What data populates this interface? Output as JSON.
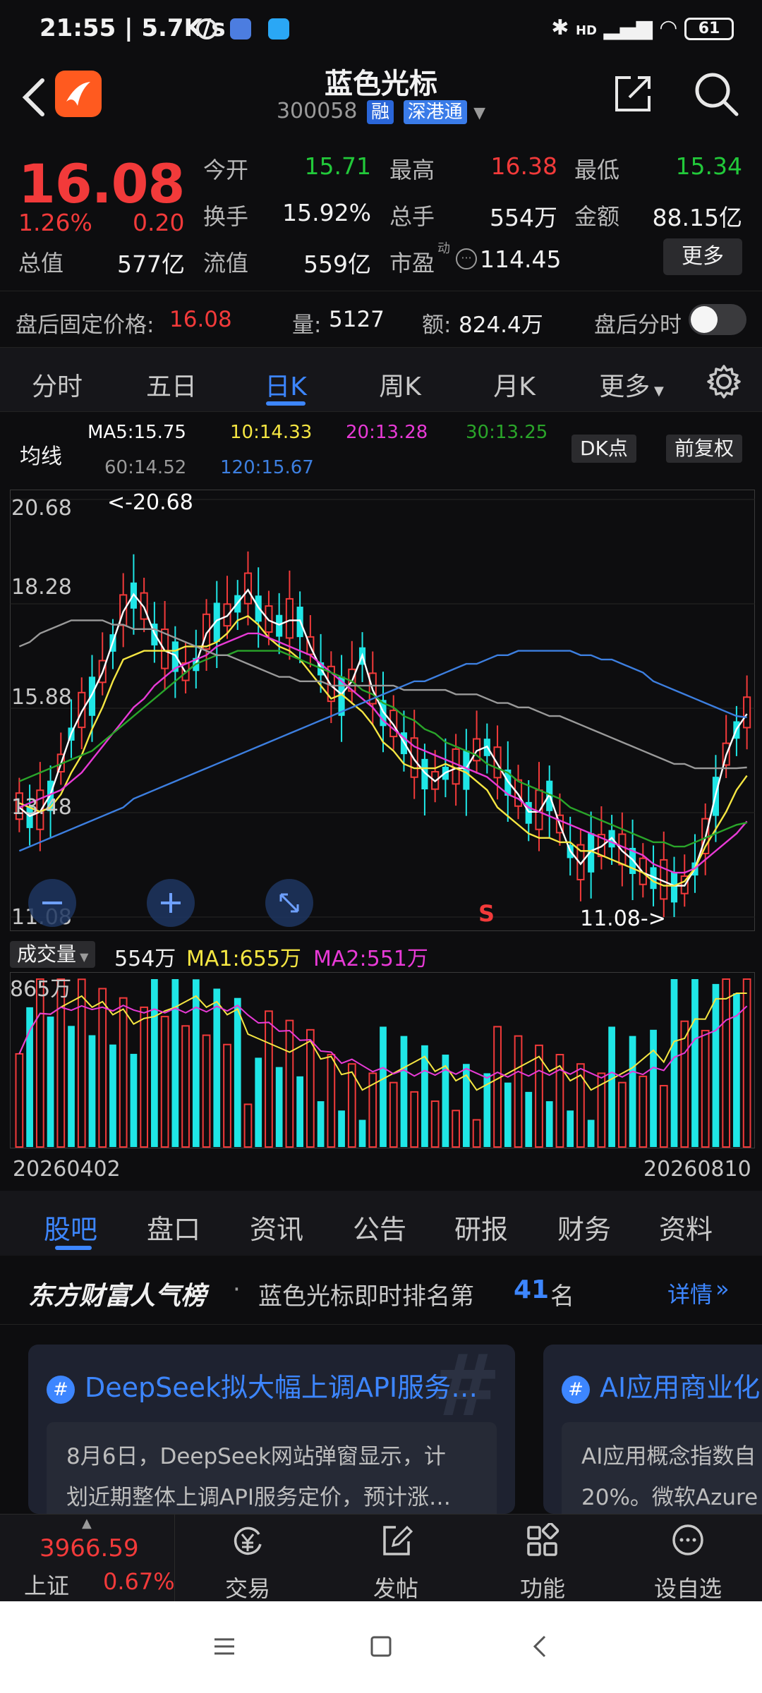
{
  "status": {
    "time": "21:55 | 5.7K/s",
    "battery": "61",
    "net": "HD"
  },
  "header": {
    "name": "蓝色光标",
    "code": "300058",
    "tag1": "融",
    "tag2": "深港通"
  },
  "quote": {
    "price": "16.08",
    "pct": "1.26%",
    "change": "0.20",
    "open_label": "今开",
    "open": "15.71",
    "high_label": "最高",
    "high": "16.38",
    "low_label": "最低",
    "low": "15.34",
    "turnover_label": "换手",
    "turnover": "15.92%",
    "hands_label": "总手",
    "hands": "554万",
    "amount_label": "金额",
    "amount": "88.15亿",
    "mcap_label": "总值",
    "mcap": "577亿",
    "float_label": "流值",
    "float": "559亿",
    "pe_label": "市盈",
    "pe_sup": "动",
    "pe": "114.45",
    "more": "更多"
  },
  "afterhours": {
    "label": "盘后固定价格:",
    "price": "16.08",
    "vol_label": "量:",
    "vol": "5127",
    "amt_label": "额:",
    "amt": "824.4万",
    "ts_label": "盘后分时"
  },
  "period_tabs": [
    "分时",
    "五日",
    "日K",
    "周K",
    "月K",
    "更多"
  ],
  "ma": {
    "title": "均线",
    "ma5": "MA5:15.75",
    "ma10": "10:14.33",
    "ma20": "20:13.28",
    "ma30": "30:13.25",
    "ma60": "60:14.52",
    "ma120": "120:15.67",
    "dk": "DK点",
    "fq": "前复权"
  },
  "colors": {
    "up": "#f23a3a",
    "down": "#1fe6e6",
    "ma5": "#ffffff",
    "ma10": "#f5e642",
    "ma20": "#e83ad6",
    "ma30": "#2aa52a",
    "ma60": "#9a9a9a",
    "ma120": "#3d7fe0",
    "accent": "#3d86ff"
  },
  "chart_data": [
    {
      "type": "candlestick",
      "title": "",
      "ylim": [
        11.08,
        20.68
      ],
      "ytick_labels": [
        "20.68",
        "18.28",
        "15.88",
        "13.48",
        "11.08"
      ],
      "annotations": [
        "<-20.68",
        "11.08->",
        "S"
      ],
      "x_labels": [
        "20260402",
        "20260810"
      ],
      "series": [
        {
          "name": "MA5",
          "values": [
            13.6,
            13.4,
            13.5,
            13.9,
            14.6,
            15.3,
            15.8,
            16.2,
            16.7,
            17.4,
            18.1,
            18.5,
            18.2,
            17.6,
            17.2,
            17.1,
            16.7,
            16.9,
            17.6,
            17.9,
            18.0,
            18.3,
            18.6,
            18.2,
            17.9,
            17.8,
            17.9,
            17.9,
            17.3,
            16.8,
            16.4,
            16.2,
            16.5,
            17.1,
            16.3,
            15.8,
            15.5,
            15.1,
            14.7,
            14.4,
            14.2,
            14.4,
            14.5,
            14.5,
            14.9,
            15.0,
            14.6,
            14.2,
            13.9,
            13.5,
            13.5,
            13.9,
            13.2,
            12.6,
            12.3,
            12.6,
            12.7,
            12.9,
            12.6,
            12.4,
            12.1,
            12.0,
            11.9,
            11.8,
            11.8,
            12.2,
            12.9,
            13.9,
            14.8,
            15.4,
            15.75
          ]
        },
        {
          "name": "MA10",
          "values": [
            13.7,
            13.6,
            13.5,
            13.6,
            13.9,
            14.4,
            14.8,
            15.4,
            15.9,
            16.5,
            17.0,
            17.1,
            17.2,
            17.2,
            17.2,
            17.2,
            17.3,
            17.3,
            17.3,
            17.4,
            17.6,
            17.9,
            18.0,
            17.8,
            17.5,
            17.3,
            17.2,
            17.0,
            16.7,
            16.4,
            16.1,
            16.2,
            16.0,
            15.8,
            15.5,
            15.1,
            14.9,
            14.6,
            14.5,
            14.5,
            14.5,
            14.6,
            14.5,
            14.4,
            14.2,
            14.0,
            13.6,
            13.4,
            13.2,
            13.0,
            12.9,
            12.9,
            12.8,
            12.8,
            12.6,
            12.6,
            12.5,
            12.4,
            12.3,
            12.2,
            12.1,
            11.9,
            11.8,
            11.8,
            11.9,
            12.2,
            12.7,
            13.1,
            13.5,
            14.0,
            14.33
          ]
        },
        {
          "name": "MA20",
          "values": [
            13.6,
            13.7,
            13.8,
            13.9,
            14.0,
            14.2,
            14.4,
            14.7,
            15.0,
            15.3,
            15.6,
            15.9,
            16.1,
            16.4,
            16.6,
            16.8,
            16.9,
            17.0,
            17.1,
            17.3,
            17.4,
            17.5,
            17.6,
            17.6,
            17.5,
            17.4,
            17.3,
            17.2,
            17.1,
            16.9,
            16.7,
            16.5,
            16.3,
            16.1,
            15.9,
            15.6,
            15.4,
            15.2,
            15.0,
            14.9,
            14.8,
            14.7,
            14.6,
            14.5,
            14.4,
            14.3,
            14.1,
            13.9,
            13.8,
            13.6,
            13.5,
            13.4,
            13.3,
            13.2,
            13.1,
            13.0,
            12.9,
            12.8,
            12.7,
            12.6,
            12.5,
            12.3,
            12.2,
            12.1,
            12.1,
            12.2,
            12.4,
            12.6,
            12.8,
            13.0,
            13.28
          ]
        },
        {
          "name": "MA30",
          "values": [
            14.2,
            14.3,
            14.4,
            14.5,
            14.6,
            14.7,
            14.8,
            14.9,
            15.1,
            15.3,
            15.5,
            15.7,
            15.9,
            16.1,
            16.3,
            16.5,
            16.7,
            16.9,
            17.0,
            17.1,
            17.1,
            17.2,
            17.2,
            17.2,
            17.2,
            17.2,
            17.1,
            17.0,
            16.9,
            16.8,
            16.7,
            16.6,
            16.5,
            16.3,
            16.2,
            16.0,
            15.9,
            15.7,
            15.6,
            15.4,
            15.3,
            15.1,
            15.0,
            14.9,
            14.8,
            14.6,
            14.5,
            14.4,
            14.2,
            14.1,
            14.0,
            13.9,
            13.8,
            13.6,
            13.5,
            13.4,
            13.3,
            13.2,
            13.1,
            13.0,
            12.9,
            12.8,
            12.8,
            12.7,
            12.7,
            12.8,
            12.9,
            13.0,
            13.1,
            13.2,
            13.25
          ]
        },
        {
          "name": "MA60",
          "values": [
            17.3,
            17.4,
            17.6,
            17.7,
            17.8,
            17.9,
            17.9,
            17.9,
            17.9,
            17.8,
            17.8,
            17.7,
            17.7,
            17.7,
            17.6,
            17.5,
            17.4,
            17.3,
            17.2,
            17.1,
            17.1,
            17.0,
            16.9,
            16.8,
            16.7,
            16.6,
            16.6,
            16.5,
            16.5,
            16.5,
            16.4,
            16.4,
            16.4,
            16.4,
            16.4,
            16.4,
            16.4,
            16.3,
            16.3,
            16.3,
            16.3,
            16.3,
            16.2,
            16.2,
            16.2,
            16.1,
            16.0,
            16.0,
            15.9,
            15.9,
            15.8,
            15.7,
            15.7,
            15.6,
            15.5,
            15.4,
            15.3,
            15.2,
            15.1,
            15.0,
            14.9,
            14.8,
            14.7,
            14.6,
            14.6,
            14.5,
            14.5,
            14.5,
            14.5,
            14.5,
            14.52
          ]
        },
        {
          "name": "MA120",
          "values": [
            12.6,
            12.7,
            12.8,
            12.9,
            13.0,
            13.1,
            13.2,
            13.3,
            13.4,
            13.5,
            13.6,
            13.8,
            13.9,
            14.0,
            14.1,
            14.2,
            14.3,
            14.4,
            14.5,
            14.6,
            14.7,
            14.8,
            14.9,
            15.0,
            15.1,
            15.2,
            15.3,
            15.4,
            15.5,
            15.6,
            15.7,
            15.8,
            15.9,
            16.0,
            16.1,
            16.2,
            16.3,
            16.4,
            16.5,
            16.5,
            16.6,
            16.7,
            16.8,
            16.9,
            16.9,
            17.0,
            17.1,
            17.1,
            17.2,
            17.2,
            17.2,
            17.2,
            17.2,
            17.2,
            17.1,
            17.1,
            17.0,
            17.0,
            16.9,
            16.8,
            16.7,
            16.5,
            16.4,
            16.3,
            16.2,
            16.1,
            16.0,
            15.9,
            15.8,
            15.7,
            15.67
          ]
        }
      ]
    },
    {
      "type": "bar",
      "title": "成交量",
      "legend": [
        "554万",
        "MA1:655万",
        "MA2:551万"
      ],
      "ytick_labels": [
        "865万"
      ],
      "volume_max": 865,
      "unit": "万",
      "x_labels": [
        "20260402",
        "20260810"
      ]
    }
  ],
  "tabs_bottom": [
    "股吧",
    "盘口",
    "资讯",
    "公告",
    "研报",
    "财务",
    "资料"
  ],
  "rank": {
    "brand": "东方财富人气榜",
    "text": "蓝色光标即时排名第",
    "num": "41",
    "suffix": "名",
    "detail": "详情"
  },
  "cards": [
    {
      "title": "DeepSeek拟大幅上调API服务…",
      "line1": "8月6日，DeepSeek网站弹窗显示，计",
      "line2": "划近期整体上调API服务定价，预计涨…"
    },
    {
      "title": "AI应用商业化",
      "line1": "AI应用概念指数自",
      "line2": "20%。微软Azure与"
    }
  ],
  "bottom_nav": {
    "index_val": "3966.59",
    "index_name": "上证",
    "index_pct": "0.67%",
    "trade": "交易",
    "post": "发帖",
    "func": "功能",
    "watch": "设自选"
  }
}
